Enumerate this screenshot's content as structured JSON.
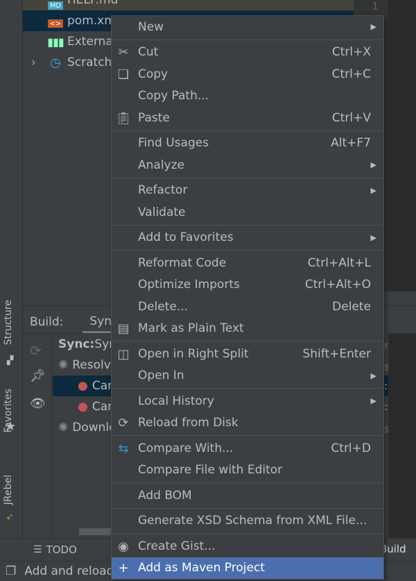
{
  "project_tree": {
    "items": [
      {
        "label": "HELP.md",
        "icon": "markdown-file-icon"
      },
      {
        "label": "pom.xml",
        "icon": "maven-xml-file-icon",
        "selected": true
      },
      {
        "label": "External Libraries",
        "icon": "libraries-icon"
      },
      {
        "label": "Scratches and Consoles",
        "icon": "scratches-icon"
      }
    ]
  },
  "editor": {
    "line_number": "1"
  },
  "left_strip": {
    "tabs": [
      "Structure",
      "Favorites",
      "JRebel"
    ]
  },
  "build": {
    "label": "Build:",
    "tab": "Sync",
    "rows": [
      {
        "bold": "Sync:",
        "text": " Sync",
        "right": "min",
        "icon": "none"
      },
      {
        "text": "Resolving",
        "right": "sec",
        "icon": "spinner-icon"
      },
      {
        "text": "Cannot resolve",
        "right": ":m",
        "icon": "error-icon",
        "selected": true
      },
      {
        "text": "Cannot resolve",
        "right": ":m",
        "icon": "error-icon"
      },
      {
        "text": "Downloading",
        "right": "sec",
        "icon": "spinner-icon"
      }
    ]
  },
  "bottom_bar": {
    "todo": "TODO",
    "build": "Build"
  },
  "status_bar": {
    "text": "Add and reload"
  },
  "colors": {
    "menu_bg": "#3c3f41",
    "highlight": "#4b6eaf",
    "selection": "#0d293e",
    "error": "#c75450",
    "accent_blue": "#3592c4"
  },
  "context_menu": {
    "groups": [
      [
        {
          "label": "New",
          "submenu": true
        }
      ],
      [
        {
          "label": "Cut",
          "shortcut": "Ctrl+X",
          "icon": "scissors-icon"
        },
        {
          "label": "Copy",
          "shortcut": "Ctrl+C",
          "icon": "copy-icon"
        },
        {
          "label": "Copy Path..."
        },
        {
          "label": "Paste",
          "shortcut": "Ctrl+V",
          "icon": "paste-icon"
        }
      ],
      [
        {
          "label": "Find Usages",
          "shortcut": "Alt+F7"
        },
        {
          "label": "Analyze",
          "submenu": true
        }
      ],
      [
        {
          "label": "Refactor",
          "submenu": true
        },
        {
          "label": "Validate"
        }
      ],
      [
        {
          "label": "Add to Favorites",
          "submenu": true
        }
      ],
      [
        {
          "label": "Reformat Code",
          "shortcut": "Ctrl+Alt+L"
        },
        {
          "label": "Optimize Imports",
          "shortcut": "Ctrl+Alt+O"
        },
        {
          "label": "Delete...",
          "shortcut": "Delete"
        },
        {
          "label": "Mark as Plain Text",
          "icon": "plain-text-icon"
        }
      ],
      [
        {
          "label": "Open in Right Split",
          "shortcut": "Shift+Enter",
          "icon": "split-icon"
        },
        {
          "label": "Open In",
          "submenu": true
        }
      ],
      [
        {
          "label": "Local History",
          "submenu": true
        },
        {
          "label": "Reload from Disk",
          "icon": "reload-icon"
        }
      ],
      [
        {
          "label": "Compare With...",
          "shortcut": "Ctrl+D",
          "icon": "compare-icon"
        },
        {
          "label": "Compare File with Editor"
        }
      ],
      [
        {
          "label": "Add BOM"
        }
      ],
      [
        {
          "label": "Generate XSD Schema from XML File..."
        }
      ],
      [
        {
          "label": "Create Gist...",
          "icon": "github-icon"
        },
        {
          "label": "Add as Maven Project",
          "icon": "plus-icon",
          "highlighted": true
        }
      ]
    ]
  }
}
